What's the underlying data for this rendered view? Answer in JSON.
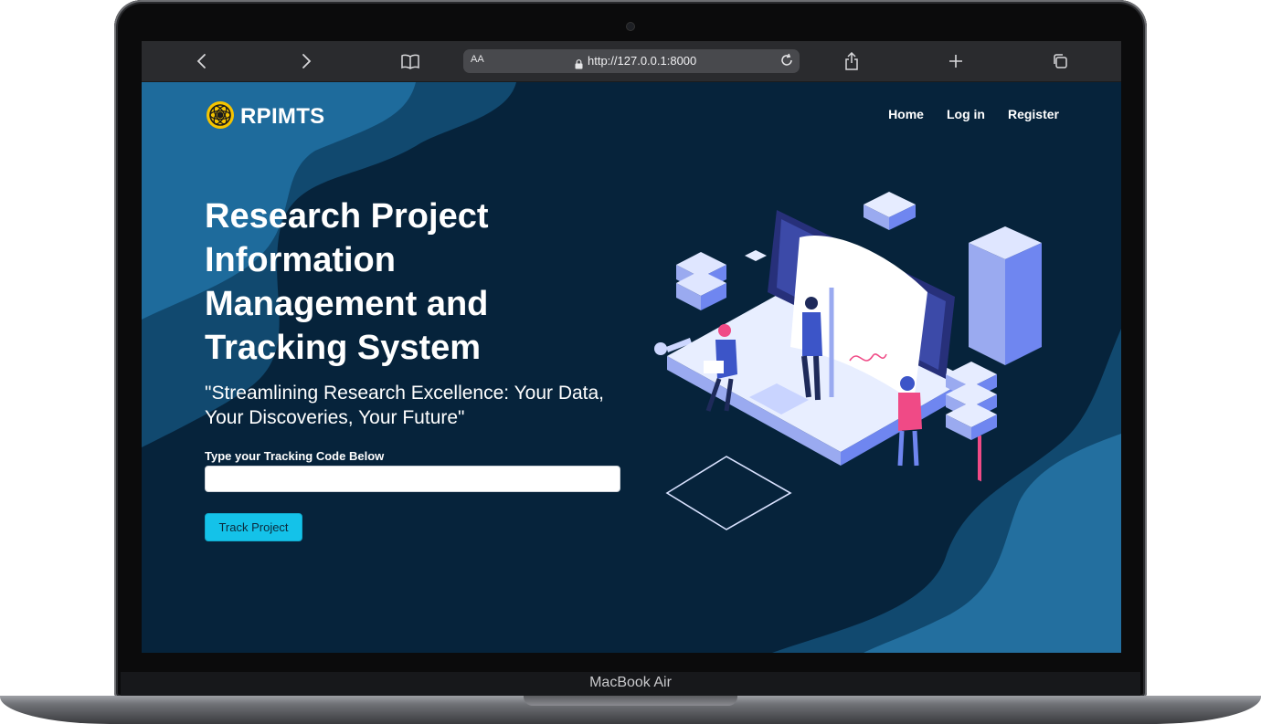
{
  "device": {
    "model_label": "MacBook Air"
  },
  "browser": {
    "url": "http://127.0.0.1:8000",
    "text_size_label": "AA",
    "icons": [
      "back-icon",
      "forward-icon",
      "bookmarks-icon",
      "lock-icon",
      "reload-icon",
      "share-icon",
      "new-tab-icon",
      "tabs-icon"
    ]
  },
  "brand": {
    "name": "RPIMTS",
    "logo_icon": "gear-emblem-icon"
  },
  "nav": {
    "home": "Home",
    "login": "Log in",
    "register": "Register"
  },
  "hero": {
    "title": "Research Project Information Management and Tracking System",
    "tagline": "\"Streamlining Research Excellence: Your Data, Your Discoveries, Your Future\"",
    "tracking_label": "Type your Tracking Code Below",
    "tracking_value": "",
    "track_button": "Track Project"
  },
  "colors": {
    "page_background": "#06233b",
    "wave_dark": "#0f4a73",
    "wave_light": "#1f6fa2",
    "button": "#14c2e9",
    "illustration_primary": "#6f86f0",
    "illustration_accent": "#f04a86"
  }
}
